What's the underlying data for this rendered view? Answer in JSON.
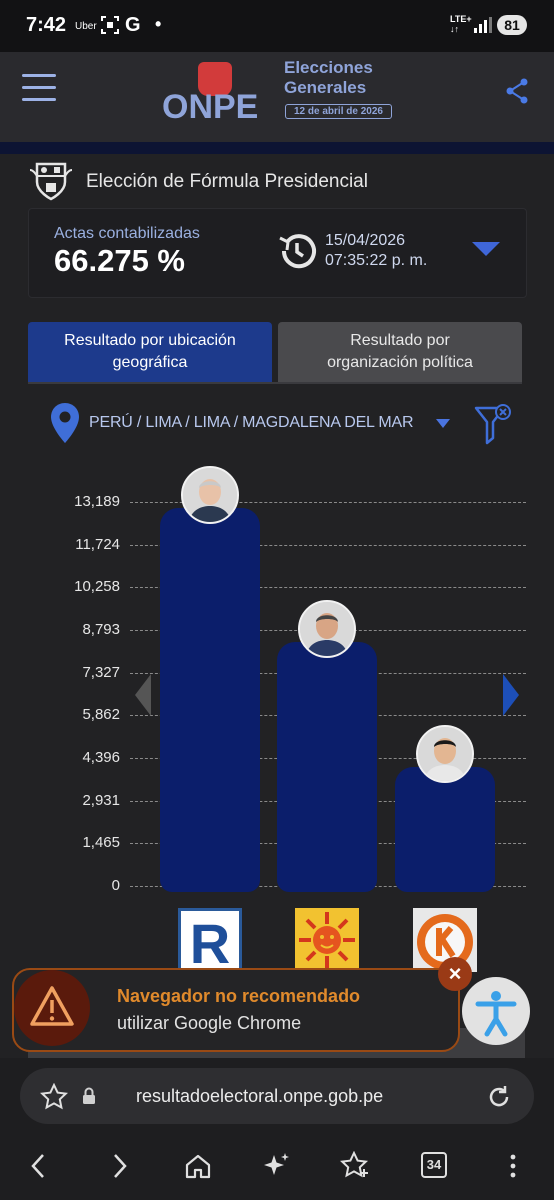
{
  "status_bar": {
    "time": "7:42",
    "uber": "Uber",
    "g": "G",
    "dot": "•",
    "lte": "LTE+",
    "battery": "81"
  },
  "header": {
    "logo": "ONPE",
    "elections_line1": "Elecciones",
    "elections_line2": "Generales",
    "date_badge": "12 de abril de 2026"
  },
  "election": {
    "title": "Elección de Fórmula Presidencial"
  },
  "actas": {
    "label": "Actas contabilizadas",
    "value": "66.275 %",
    "date": "15/04/2026",
    "time": "07:35:22 p. m."
  },
  "tabs": [
    {
      "line1": "Resultado por ubicación",
      "line2": "geográfica",
      "active": true
    },
    {
      "line1": "Resultado por",
      "line2": "organización política",
      "active": false
    }
  ],
  "location": {
    "path": "PERÚ / LIMA / LIMA / MAGDALENA DEL MAR"
  },
  "chart_data": {
    "type": "bar",
    "categories": [
      "R",
      "Sol",
      "K"
    ],
    "values": [
      13189,
      8600,
      4300
    ],
    "yticks": [
      "13,189",
      "11,724",
      "10,258",
      "8,793",
      "7,327",
      "5,862",
      "4,396",
      "2,931",
      "1,465",
      "0"
    ],
    "ylim": [
      0,
      13189
    ],
    "bar_color": "#0b1e6b"
  },
  "toast": {
    "title": "Navegador no recomendado",
    "subtitle": "utilizar Google Chrome",
    "close": "×"
  },
  "browser": {
    "url": "resultadoelectoral.onpe.gob.pe",
    "tabs_count": "34"
  },
  "colors": {
    "accent": "#3f66d8",
    "tab_active": "#1d3a8c",
    "warning": "#e08a2c"
  }
}
